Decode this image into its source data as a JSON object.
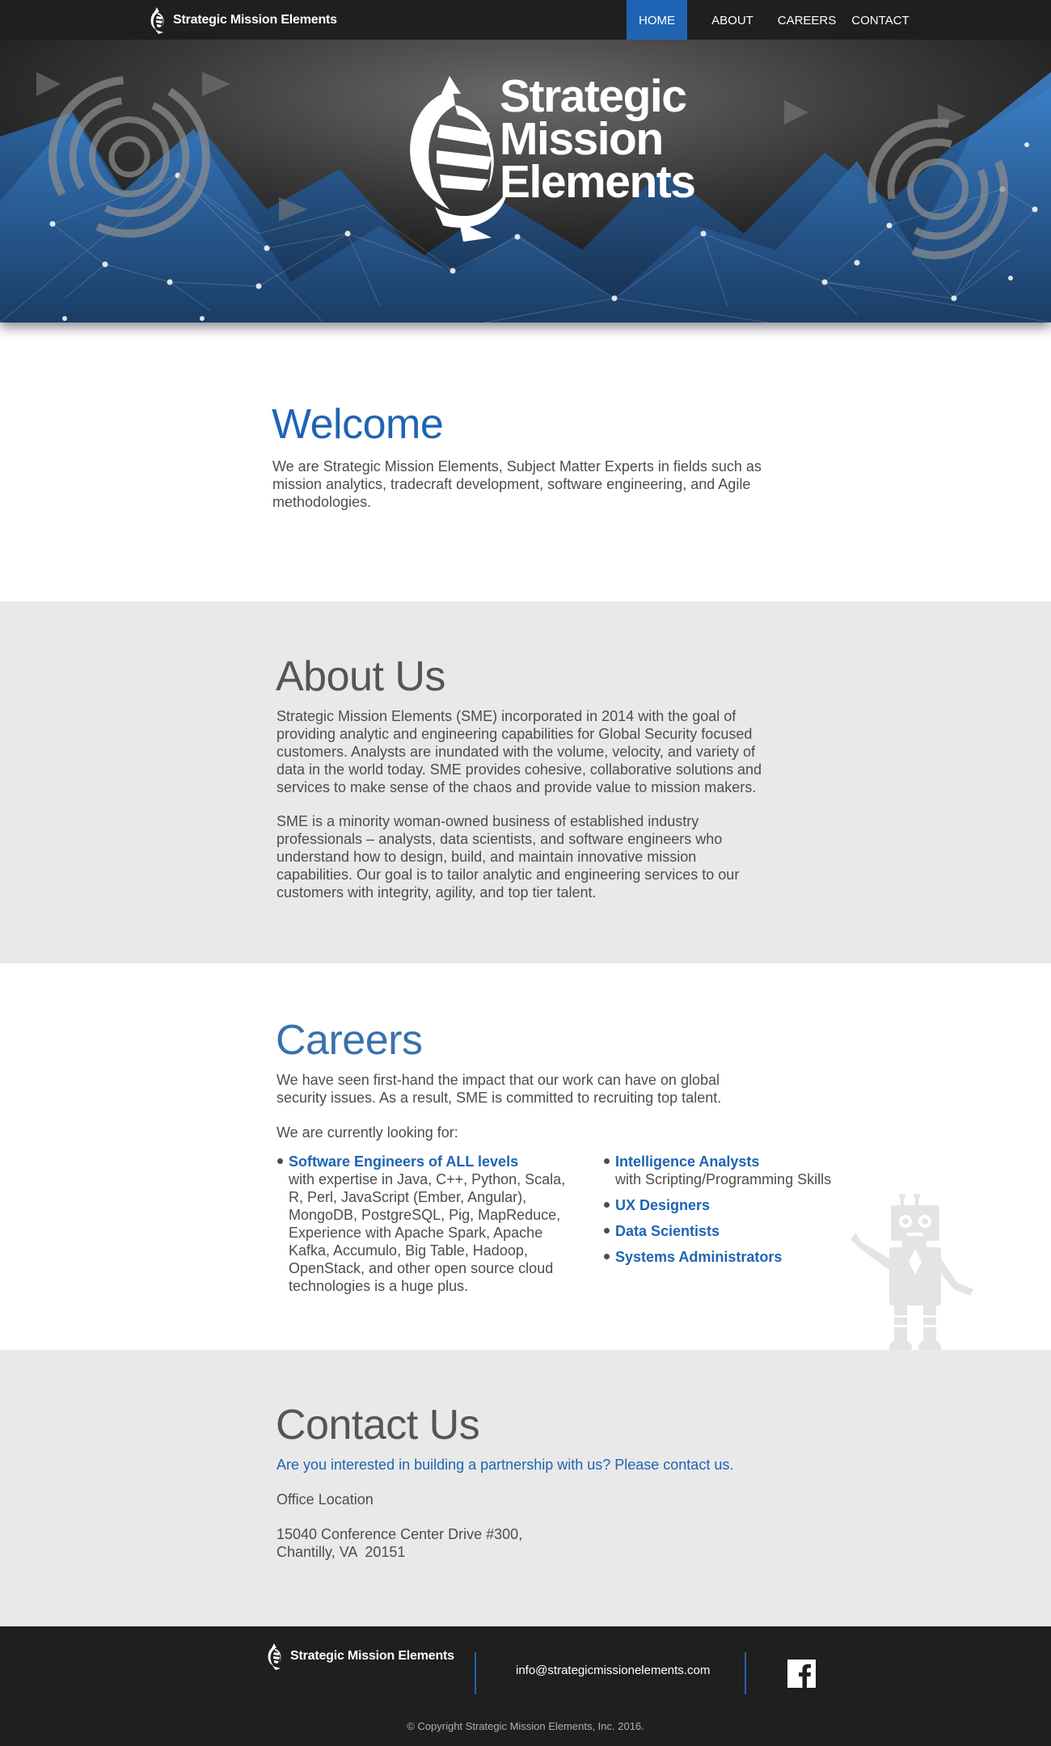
{
  "nav": {
    "brand": "Strategic Mission Elements",
    "items": [
      {
        "label": "HOME",
        "active": true
      },
      {
        "label": "ABOUT",
        "active": false
      },
      {
        "label": "CAREERS",
        "active": false
      },
      {
        "label": "CONTACT",
        "active": false
      }
    ]
  },
  "hero": {
    "title_lines": [
      "Strategic",
      "Mission",
      "Elements"
    ]
  },
  "welcome": {
    "heading": "Welcome",
    "lines": [
      "We are Strategic Mission Elements, Subject Matter Experts in fields such as",
      "mission analytics, tradecraft development, software engineering, and Agile",
      "methodologies."
    ]
  },
  "about": {
    "heading": "About Us",
    "para1": [
      "Strategic Mission Elements (SME) incorporated in 2014 with the goal of",
      "providing analytic and engineering capabilities for Global Security focused",
      "customers. Analysts are inundated with the volume, velocity, and variety of",
      "data in the world today. SME provides cohesive, collaborative solutions and",
      "services to make sense of the chaos and provide value to mission makers."
    ],
    "para2": [
      "SME is a minority woman-owned business of established industry",
      "professionals – analysts, data scientists, and software engineers who",
      "understand how to design, build, and maintain innovative mission",
      "capabilities. Our goal is to tailor analytic and engineering services to our",
      "customers with integrity, agility, and top tier talent."
    ]
  },
  "careers": {
    "heading": "Careers",
    "intro": [
      "We have seen first-hand the impact that our work can have on global",
      "security issues. As a result, SME is committed to recruiting top talent."
    ],
    "looking": "We are currently looking for:",
    "jobs_left": [
      {
        "title": "Software Engineers of ALL levels",
        "desc": [
          "with expertise in Java, C++, Python, Scala,",
          "R, Perl, JavaScript (Ember, Angular),",
          "MongoDB, PostgreSQL, Pig, MapReduce,",
          "Experience with Apache Spark, Apache",
          "Kafka, Accumulo, Big Table, Hadoop,",
          "OpenStack, and other open source cloud",
          "technologies is a huge plus."
        ]
      }
    ],
    "jobs_right": [
      {
        "title": "Intelligence Analysts",
        "desc": [
          "with Scripting/Programming Skills"
        ]
      },
      {
        "title": "UX Designers",
        "desc": []
      },
      {
        "title": "Data Scientists",
        "desc": []
      },
      {
        "title": "Systems Administrators",
        "desc": []
      }
    ]
  },
  "contact": {
    "heading": "Contact Us",
    "cta": "Are you interested in building a partnership with us? Please contact us.",
    "office_label": "Office Location",
    "address": [
      "15040 Conference Center Drive #300,",
      "Chantilly, VA  20151"
    ]
  },
  "footer": {
    "brand": "Strategic Mission Elements",
    "email": "info@strategicmissionelements.com",
    "facebook_icon": "facebook-icon",
    "copyright": "© Copyright Strategic Mission Elements, Inc. 2016."
  },
  "colors": {
    "accent": "#1f64b4",
    "nav_bg": "#1f1f1f",
    "section_grey": "#e9e9e9",
    "hero_blue": "#3a7fc8"
  }
}
